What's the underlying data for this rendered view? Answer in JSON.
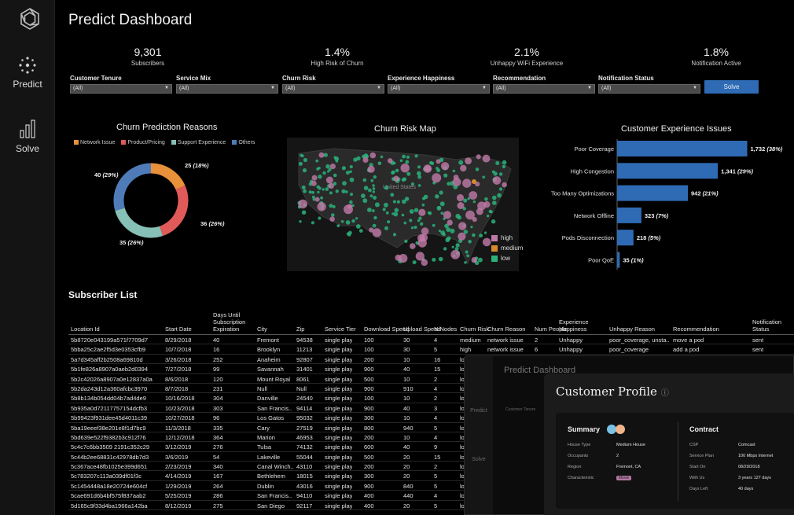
{
  "sidebar": {
    "items": [
      {
        "label": "Predict",
        "icon": "predict-icon"
      },
      {
        "label": "Solve",
        "icon": "bar-chart-icon"
      }
    ]
  },
  "header": {
    "title": "Predict Dashboard"
  },
  "kpis": [
    {
      "value": "9,301",
      "label": "Subscribers"
    },
    {
      "value": "1.4%",
      "label": "High Risk of Churn"
    },
    {
      "value": "2.1%",
      "label": "Unhappy WiFi Experience"
    },
    {
      "value": "1.8%",
      "label": "Notification Active"
    }
  ],
  "filters": [
    {
      "label": "Customer Tenure",
      "value": "(All)"
    },
    {
      "label": "Service Mix",
      "value": "(All)"
    },
    {
      "label": "Churn Risk",
      "value": "(All)"
    },
    {
      "label": "Experience Happiness",
      "value": "(All)"
    },
    {
      "label": "Recommendation",
      "value": "(All)"
    },
    {
      "label": "Notification Status",
      "value": "(All)"
    }
  ],
  "solve_label": "Solve",
  "colors": {
    "network": "#e8913a",
    "product": "#e05a5a",
    "support": "#86c0b6",
    "others": "#4f7cb9",
    "high": "#c07aa7",
    "medium": "#d98a2a",
    "low": "#2ab27b",
    "bar": "#2f6bb5"
  },
  "donut": {
    "title": "Churn Prediction Reasons",
    "legend": [
      "Network Issue",
      "Product/Pricing",
      "Support Experience",
      "Others"
    ],
    "labels": [
      {
        "num": "25",
        "pct": "(18%)"
      },
      {
        "num": "36",
        "pct": "(26%)"
      },
      {
        "num": "35",
        "pct": "(26%)"
      },
      {
        "num": "40",
        "pct": "(29%)"
      }
    ]
  },
  "map": {
    "title": "Churn Risk Map",
    "country_label": "United States",
    "legend": [
      "high",
      "medium",
      "low"
    ]
  },
  "chart_data": {
    "type": "bar",
    "title": "Customer Experience Issues",
    "categories": [
      "Poor Coverage",
      "High Congestion",
      "Too Many Optimizations",
      "Network Offline",
      "Pods Disconnection",
      "Poor QoE"
    ],
    "values": [
      1732,
      1341,
      942,
      323,
      218,
      35
    ],
    "value_labels": [
      "1,732",
      "1,341",
      "942",
      "323",
      "218",
      "35"
    ],
    "pct_labels": [
      "(38%)",
      "(29%)",
      "(21%)",
      "(7%)",
      "(5%)",
      "(1%)"
    ],
    "xlim": [
      0,
      1800
    ]
  },
  "subscriber_list": {
    "title": "Subscriber List",
    "columns": [
      "Location Id",
      "Start Date",
      "Days Until Subscription Expiration",
      "City",
      "Zip",
      "Service Tier",
      "Download Speed",
      "Upload Speed",
      "N Nodes",
      "Churn Risk",
      "Churn Reason",
      "Num People",
      "Experience Happiness",
      "Unhappy Reason",
      "Recommendation",
      "Notification Status"
    ],
    "rows": [
      [
        "5b8720e043199a571f7709d7",
        "8/29/2018",
        "40",
        "Fremont",
        "94538",
        "single play",
        "100",
        "30",
        "4",
        "medium",
        "network issue",
        "2",
        "Unhappy",
        "poor_coverage, unsta..",
        "move a pod",
        "sent"
      ],
      [
        "5bba25c2ae2f5d3e0353cfb9",
        "10/7/2018",
        "16",
        "Brooklyn",
        "11213",
        "single play",
        "100",
        "30",
        "5",
        "high",
        "network issue",
        "6",
        "Unhappy",
        "poor_coverage",
        "add a pod",
        "sent"
      ],
      [
        "5a7d345aff2b2508a69810d",
        "3/26/2018",
        "252",
        "Anaheim",
        "92807",
        "single play",
        "200",
        "10",
        "16",
        "low",
        "",
        "",
        "",
        "",
        "",
        ""
      ],
      [
        "5b1fe826a8907a0aeb2d0394",
        "7/27/2018",
        "99",
        "Savannah",
        "31401",
        "single play",
        "900",
        "40",
        "15",
        "low",
        "",
        "",
        "",
        "",
        "",
        ""
      ],
      [
        "5b2c42026a8907a0e12837a0a",
        "8/6/2018",
        "120",
        "Mount Royal",
        "8061",
        "single play",
        "500",
        "10",
        "2",
        "low",
        "",
        "",
        "",
        "",
        "",
        ""
      ],
      [
        "5b2da243d12a360afcbc3970",
        "8/7/2018",
        "231",
        "Null",
        "Null",
        "single play",
        "900",
        "910",
        "4",
        "low",
        "",
        "",
        "",
        "",
        "",
        ""
      ],
      [
        "5b8b134b054dd04b7ad4de9",
        "10/16/2018",
        "304",
        "Danville",
        "24540",
        "single play",
        "100",
        "10",
        "2",
        "low",
        "",
        "",
        "",
        "",
        "",
        ""
      ],
      [
        "5b935a0d72117757154dcfb3",
        "10/23/2018",
        "303",
        "San Francis..",
        "94114",
        "single play",
        "900",
        "40",
        "3",
        "low",
        "",
        "",
        "",
        "",
        "",
        ""
      ],
      [
        "5b99423f931dee45d4011c39",
        "10/27/2018",
        "96",
        "Los Gatos",
        "95032",
        "single play",
        "300",
        "10",
        "4",
        "low",
        "",
        "",
        "",
        "",
        "",
        ""
      ],
      [
        "5ba19eeef38e201e8f1d7bc9",
        "11/3/2018",
        "335",
        "Cary",
        "27519",
        "single play",
        "800",
        "940",
        "5",
        "low",
        "",
        "",
        "",
        "",
        "",
        ""
      ],
      [
        "5bd639e522f9382b3c912f76",
        "12/12/2018",
        "364",
        "Marion",
        "46953",
        "single play",
        "200",
        "10",
        "4",
        "low",
        "",
        "",
        "",
        "",
        "",
        ""
      ],
      [
        "5c4c7c6bb3509 2191c352c29",
        "3/12/2019",
        "276",
        "Tulsa",
        "74132",
        "single play",
        "600",
        "40",
        "9",
        "low",
        "",
        "",
        "",
        "",
        "",
        ""
      ],
      [
        "5c44b2ee68831c42978db7d3",
        "3/6/2019",
        "54",
        "Lakeville",
        "55044",
        "single play",
        "500",
        "20",
        "15",
        "low",
        "",
        "",
        "",
        "",
        "",
        ""
      ],
      [
        "5c367ace48fb1025e399d651",
        "2/23/2019",
        "340",
        "Canal Winch..",
        "43110",
        "single play",
        "200",
        "20",
        "2",
        "low",
        "",
        "",
        "",
        "",
        "",
        ""
      ],
      [
        "5c783207c113a039df01f3c",
        "4/14/2019",
        "167",
        "Bethlehem",
        "18015",
        "single play",
        "300",
        "20",
        "5",
        "low",
        "",
        "",
        "",
        "",
        "",
        ""
      ],
      [
        "5c1454448a18e20724e604cf",
        "1/29/2019",
        "264",
        "Dublin",
        "43016",
        "single play",
        "900",
        "840",
        "5",
        "low",
        "",
        "",
        "",
        "",
        "",
        ""
      ],
      [
        "5cae691d6b4bf575f837aab2",
        "5/25/2019",
        "286",
        "San Francis..",
        "94110",
        "single play",
        "400",
        "440",
        "4",
        "low",
        "",
        "",
        "",
        "",
        "",
        ""
      ],
      [
        "5d165c9f33d4ba1966a142ba",
        "8/12/2019",
        "275",
        "San Diego",
        "92117",
        "single play",
        "400",
        "20",
        "5",
        "low",
        "",
        "",
        "",
        "",
        "",
        ""
      ]
    ]
  },
  "overlay": {
    "background_title": "Predict Dashboard",
    "side_labels": [
      "Predict",
      "Solve"
    ],
    "filter_label": "Customer Tenure",
    "filter_value": "(All)",
    "title": "Customer Profile",
    "summary": {
      "heading": "Summary",
      "fields": [
        {
          "k": "House Type",
          "v": "Medium House"
        },
        {
          "k": "Occupants",
          "v": "2"
        },
        {
          "k": "Region",
          "v": "Fremont, CA"
        },
        {
          "k": "Characteristic",
          "v": "Movie"
        }
      ]
    },
    "contract": {
      "heading": "Contract",
      "fields": [
        {
          "k": "CSP",
          "v": "Comcast"
        },
        {
          "k": "Service Plan",
          "v": "100 Mbps Internet"
        },
        {
          "k": "Start On",
          "v": "08/29/2018"
        },
        {
          "k": "With Us",
          "v": "3 years 127 days"
        },
        {
          "k": "Days Left",
          "v": "40 days"
        }
      ]
    }
  }
}
